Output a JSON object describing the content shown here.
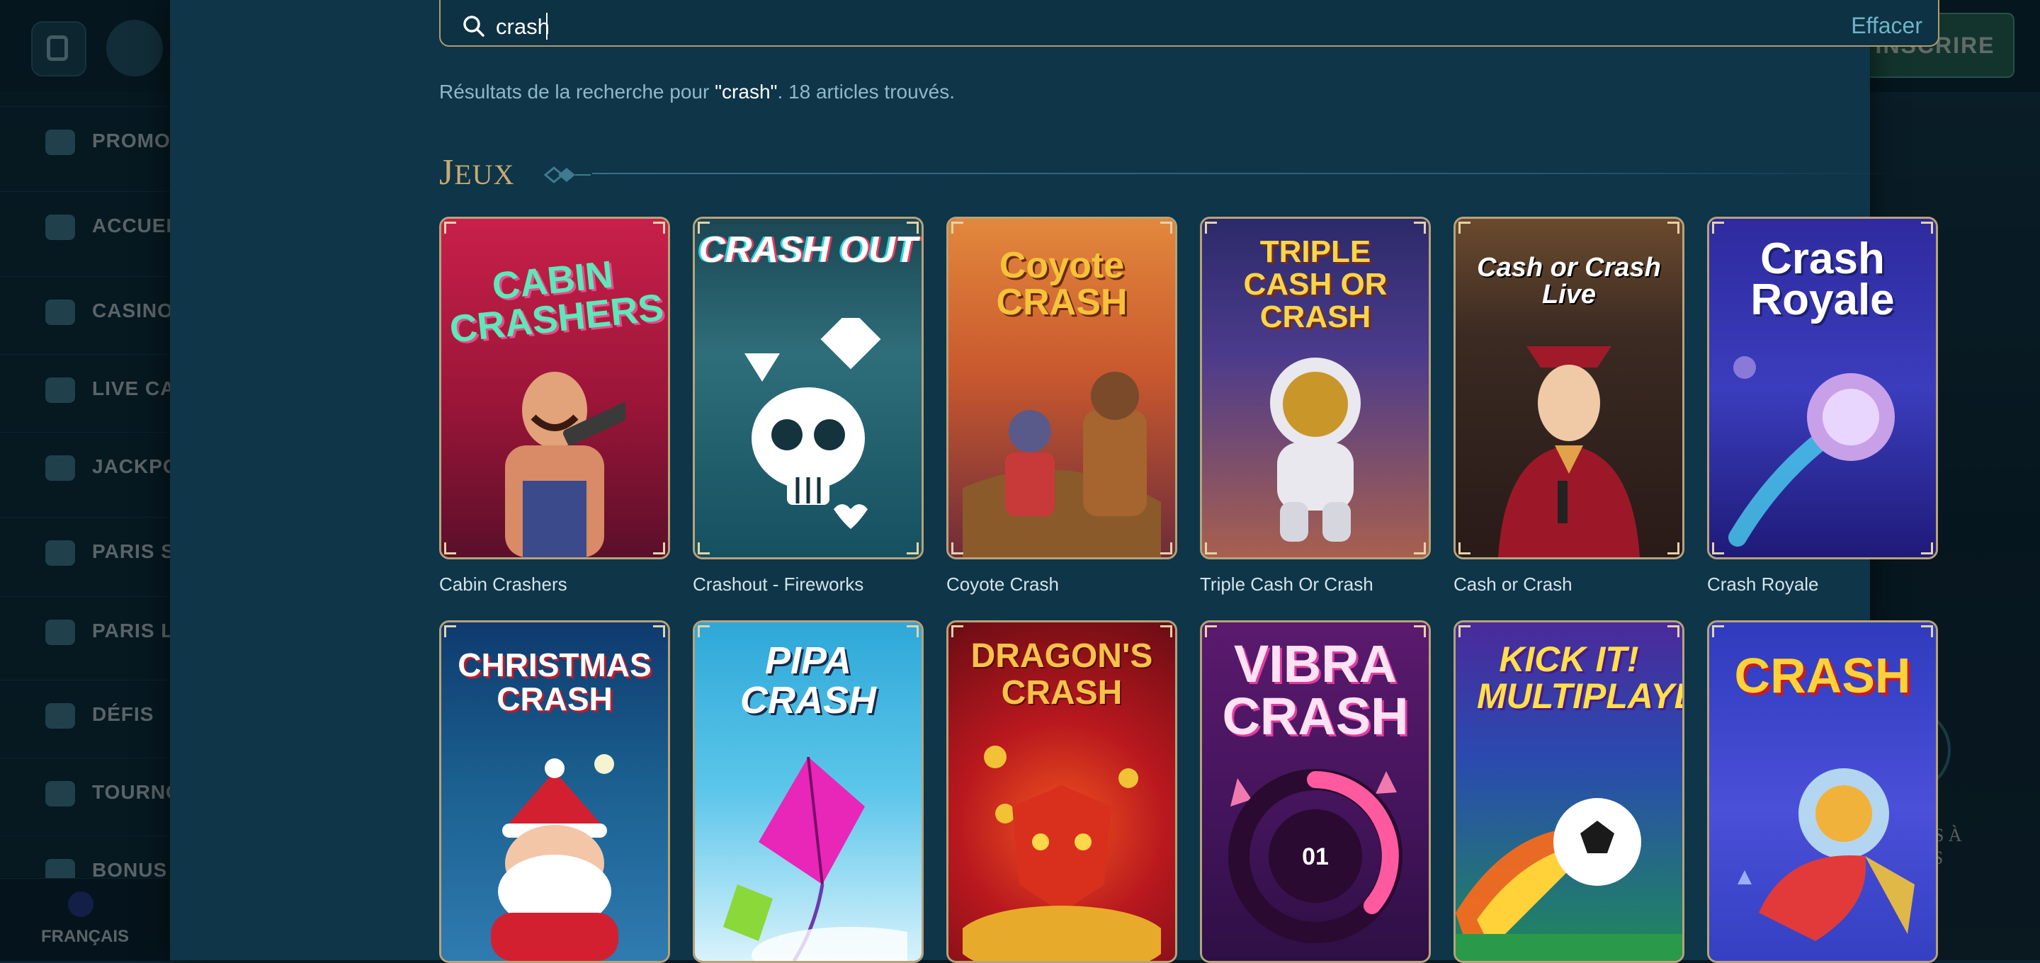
{
  "background": {
    "signup_label": "INSCRIRE",
    "nav_items": [
      {
        "label": "PROMOT"
      },
      {
        "label": "ACCUEIL"
      },
      {
        "label": "CASINO"
      },
      {
        "label": "LIVE CAS"
      },
      {
        "label": "JACKPO"
      },
      {
        "label": "PARIS SI"
      },
      {
        "label": "PARIS LI"
      },
      {
        "label": "DÉFIS"
      },
      {
        "label": "TOURNO"
      },
      {
        "label": "BONUS"
      }
    ],
    "language": "FRANÇAIS",
    "right_promo_label": "CHINES À SOUS"
  },
  "search": {
    "value": "crash",
    "clear_label": "Effacer"
  },
  "results": {
    "prefix": "Résultats de la recherche pour ",
    "query": "\"crash\"",
    "suffix": ". 18 articles trouvés."
  },
  "section": {
    "title_initial": "J",
    "title_rest": "EUX"
  },
  "games": [
    {
      "name": "Cabin Crashers",
      "logo": "CABIN CRASHERS"
    },
    {
      "name": "Crashout - Fireworks",
      "logo": "CRASH OUT"
    },
    {
      "name": "Coyote Crash",
      "logo": "Coyote CRASH"
    },
    {
      "name": "Triple Cash Or Crash",
      "logo": "TRIPLE CASH OR CRASH"
    },
    {
      "name": "Cash or Crash",
      "logo": "Cash or Crash Live"
    },
    {
      "name": "Crash Royale",
      "logo": "Crash Royale"
    },
    {
      "name": "",
      "logo": "CHRISTMAS CRASH"
    },
    {
      "name": "",
      "logo": "PIPA CRASH"
    },
    {
      "name": "",
      "logo": "DRAGON'S CRASH"
    },
    {
      "name": "",
      "logo": "VIBRA CRASH"
    },
    {
      "name": "",
      "logo": "KICK IT! MULTIPLAYER"
    },
    {
      "name": "",
      "logo": "CRASH"
    }
  ]
}
